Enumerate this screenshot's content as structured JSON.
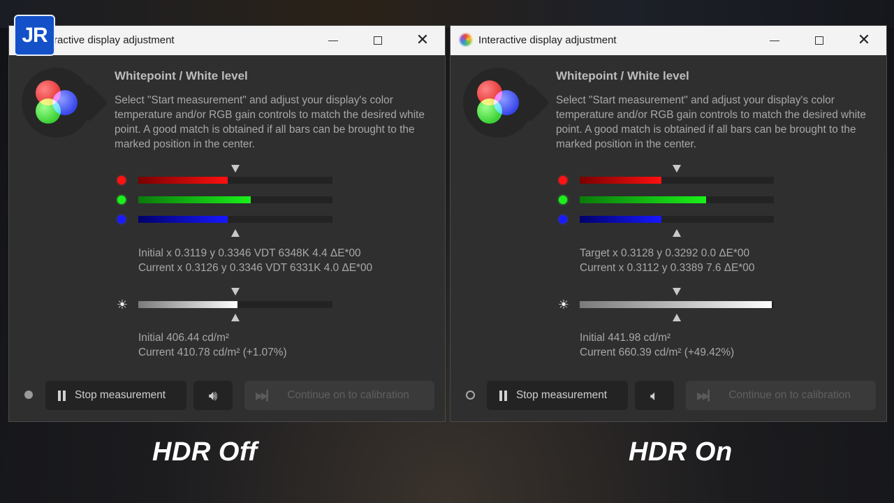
{
  "watermark": {
    "text": "JR"
  },
  "windows": [
    {
      "title": "Interactive display adjustment",
      "title_visible": "ractive display adjustment",
      "heading": "Whitepoint / White level",
      "description": "Select \"Start measurement\" and adjust your display's color temperature and/or RGB gain controls to match the desired white point. A good match is obtained if all bars can be brought to the marked position in the center.",
      "bars": {
        "red": 0.46,
        "green": 0.58,
        "blue": 0.46,
        "luminance": 0.51
      },
      "color_readout": {
        "line1": "Initial x 0.3119 y 0.3346 VDT 6348K 4.4 ΔE*00",
        "line2": "Current x 0.3126 y 0.3346 VDT 6331K 4.0 ΔE*00"
      },
      "luminance_readout": {
        "line1": "Initial 406.44 cd/m²",
        "line2": "Current 410.78 cd/m² (+1.07%)"
      },
      "buttons": {
        "stop": "Stop measurement",
        "sound_icon": "speaker-on-icon",
        "continue": "Continue on to calibration"
      },
      "status_icon": "filled-dot"
    },
    {
      "title": "Interactive display adjustment",
      "heading": "Whitepoint / White level",
      "description": "Select \"Start measurement\" and adjust your display's color temperature and/or RGB gain controls to match the desired white point. A good match is obtained if all bars can be brought to the marked position in the center.",
      "bars": {
        "red": 0.42,
        "green": 0.65,
        "blue": 0.42,
        "luminance": 0.99
      },
      "color_readout": {
        "line1": "Target x 0.3128 y 0.3292 0.0 ΔE*00",
        "line2": "Current x 0.3112 y 0.3389 7.6 ΔE*00"
      },
      "luminance_readout": {
        "line1": "Initial 441.98 cd/m²",
        "line2": "Current 660.39 cd/m² (+49.42%)"
      },
      "buttons": {
        "stop": "Stop measurement",
        "sound_icon": "speaker-muted-icon",
        "continue": "Continue on to calibration"
      },
      "status_icon": "ring"
    }
  ],
  "captions": {
    "left": "HDR Off",
    "right": "HDR On"
  }
}
